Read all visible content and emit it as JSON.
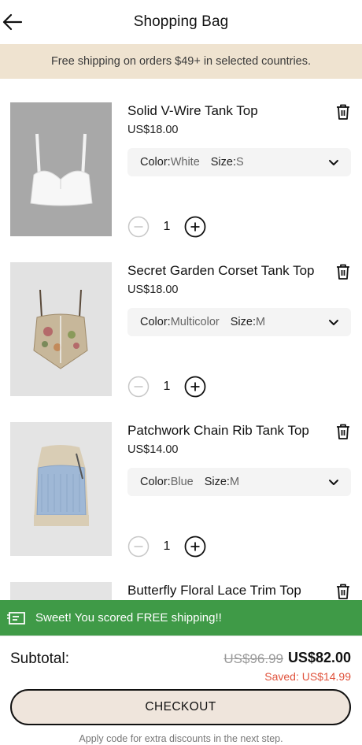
{
  "header": {
    "title": "Shopping Bag",
    "back_icon": "back-arrow-icon"
  },
  "banner": {
    "text": "Free shipping on orders $49+ in selected countries."
  },
  "items": [
    {
      "title": "Solid V-Wire Tank Top",
      "price": "US$18.00",
      "color_label": "Color:",
      "color": "White",
      "size_label": "Size:",
      "size": "S",
      "quantity": "1"
    },
    {
      "title": "Secret Garden Corset Tank Top",
      "price": "US$18.00",
      "color_label": "Color:",
      "color": "Multicolor",
      "size_label": "Size:",
      "size": "M",
      "quantity": "1"
    },
    {
      "title": "Patchwork Chain Rib Tank Top",
      "price": "US$14.00",
      "color_label": "Color:",
      "color": "Blue",
      "size_label": "Size:",
      "size": "M",
      "quantity": "1"
    },
    {
      "title": "Butterfly Floral Lace Trim Top"
    }
  ],
  "promo": {
    "text": "Sweet! You scored FREE shipping!!",
    "color": "#3f9a47"
  },
  "footer": {
    "subtotal_label": "Subtotal:",
    "original_price": "US$96.99",
    "total": "US$82.00",
    "saved": "Saved: US$14.99",
    "checkout_label": "CHECKOUT",
    "hint": "Apply code for extra discounts in the next step."
  },
  "colors": {
    "accent_saved": "#e0523c",
    "banner_bg": "#efe3d0",
    "checkout_bg": "#efe5dc"
  }
}
